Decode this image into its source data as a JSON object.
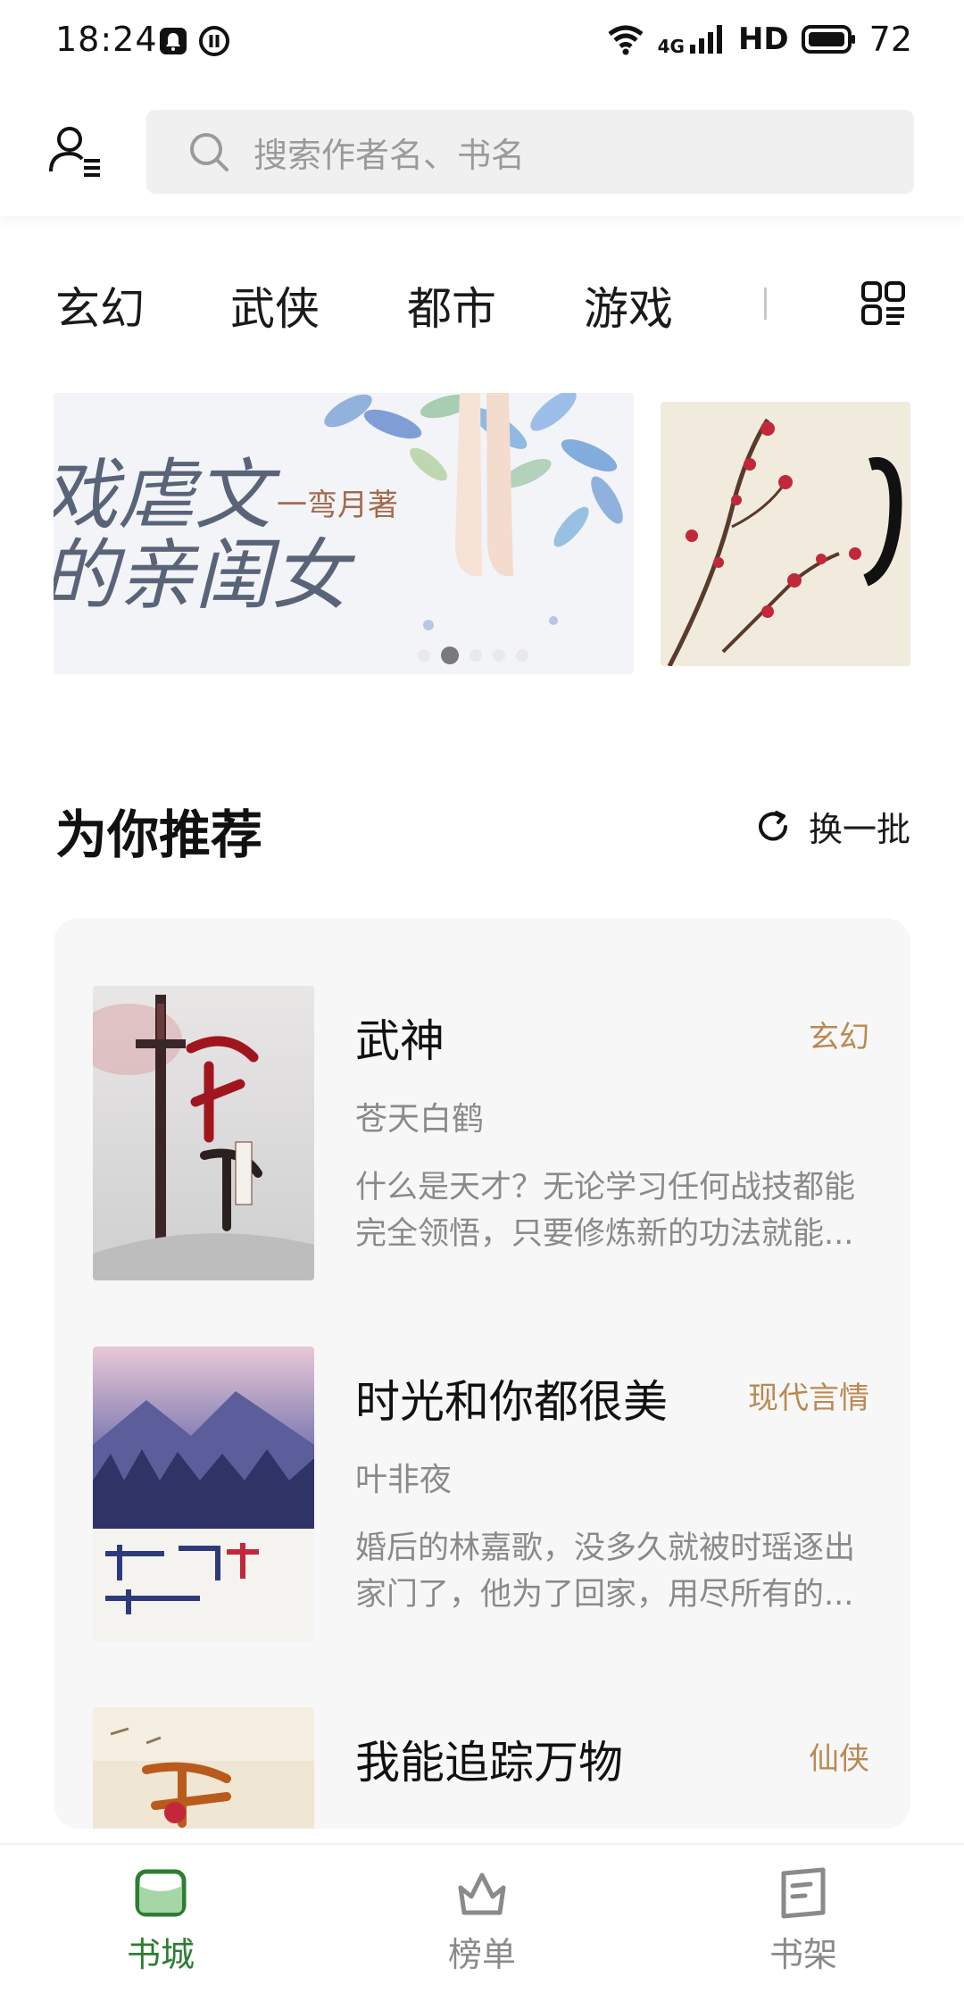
{
  "status_bar": {
    "time": "18:24",
    "network": "4G",
    "hd": "HD",
    "battery": "72"
  },
  "header": {
    "search_placeholder": "搜索作者名、书名"
  },
  "category_tabs": [
    "玄幻",
    "武侠",
    "都市",
    "游戏"
  ],
  "banner": {
    "main_title_line1": "戏虐文",
    "main_title_line2": "的亲闺女",
    "main_author": "一弯月著",
    "slide_count": 5,
    "active_slide": 2
  },
  "recommend": {
    "title": "为你推荐",
    "refresh_label": "换一批",
    "books": [
      {
        "title": "武神",
        "tag": "玄幻",
        "author": "苍天白鹤",
        "desc": "什么是天才？无论学习任何战技都能完全领悟，只要修炼新的功法就能..."
      },
      {
        "title": "时光和你都很美",
        "tag": "现代言情",
        "author": "叶非夜",
        "desc": "婚后的林嘉歌，没多久就被时瑶逐出家门了，他为了回家，用尽所有的..."
      },
      {
        "title": "我能追踪万物",
        "tag": "仙侠",
        "author": "",
        "desc": ""
      }
    ]
  },
  "bottom_nav": [
    {
      "label": "书城",
      "active": true
    },
    {
      "label": "榜单",
      "active": false
    },
    {
      "label": "书架",
      "active": false
    }
  ],
  "colors": {
    "accent_green": "#2e7d32",
    "tag_gold": "#b98a52",
    "muted_text": "#8a8a8a"
  }
}
